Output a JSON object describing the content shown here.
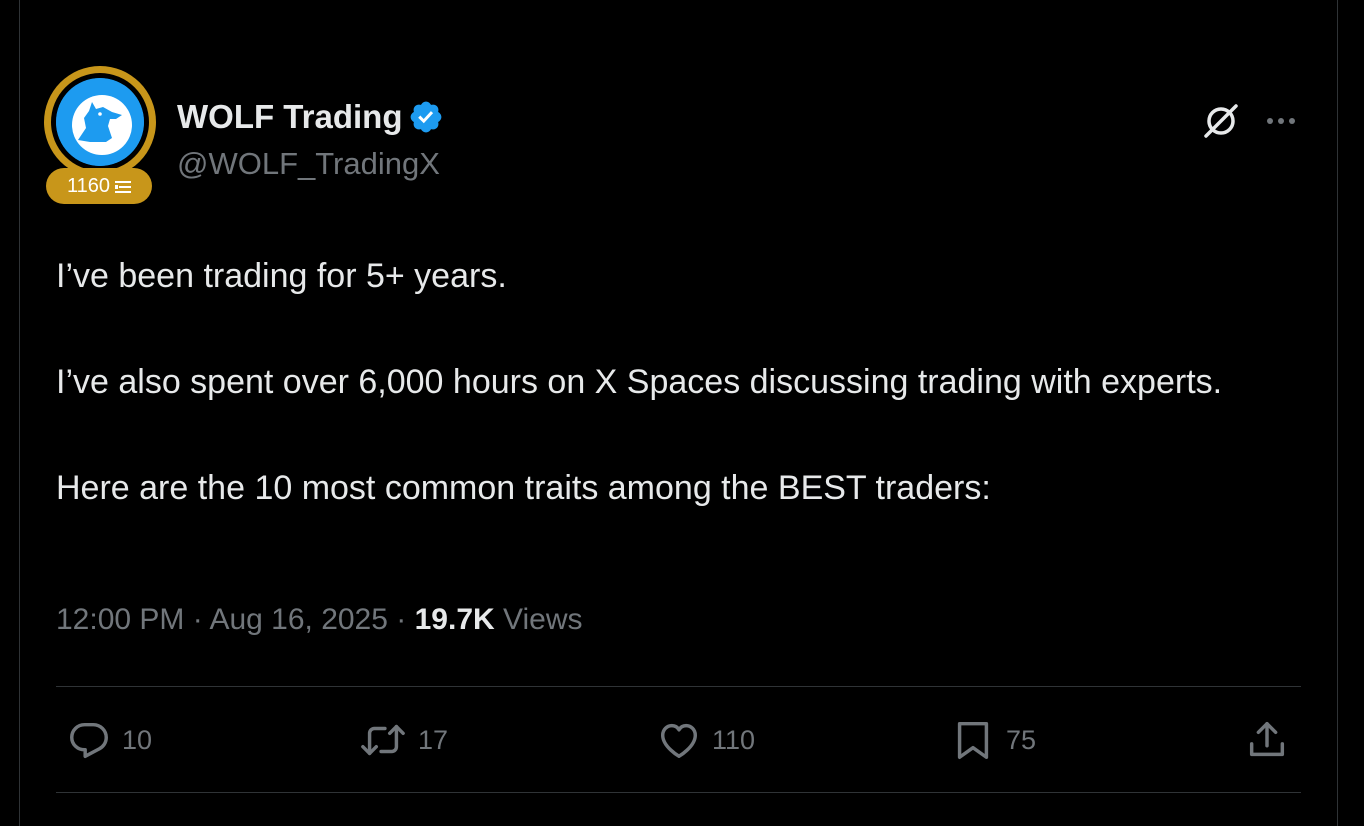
{
  "author": {
    "display_name": "WOLF Trading",
    "handle": "@WOLF_TradingX",
    "level": "1160",
    "verified": true,
    "avatar_icon": "wolf-howling-icon",
    "ring_color": "#c8961a",
    "avatar_color": "#1d9bf0",
    "verified_color": "#1d9bf0"
  },
  "header_icons": {
    "grok": "grok-icon",
    "more": "more-icon"
  },
  "tweet": {
    "line1": "I’ve been trading for 5+ years.",
    "line2": "I’ve also spent over 6,000 hours on X Spaces discussing trading with experts.",
    "line3": "Here are the 10 most common traits among the BEST traders:"
  },
  "meta": {
    "time": "12:00 PM",
    "separator": " · ",
    "date": "Aug 16, 2025",
    "views_count": "19.7K",
    "views_label": " Views"
  },
  "actions": {
    "replies": "10",
    "reposts": "17",
    "likes": "110",
    "bookmarks": "75"
  }
}
